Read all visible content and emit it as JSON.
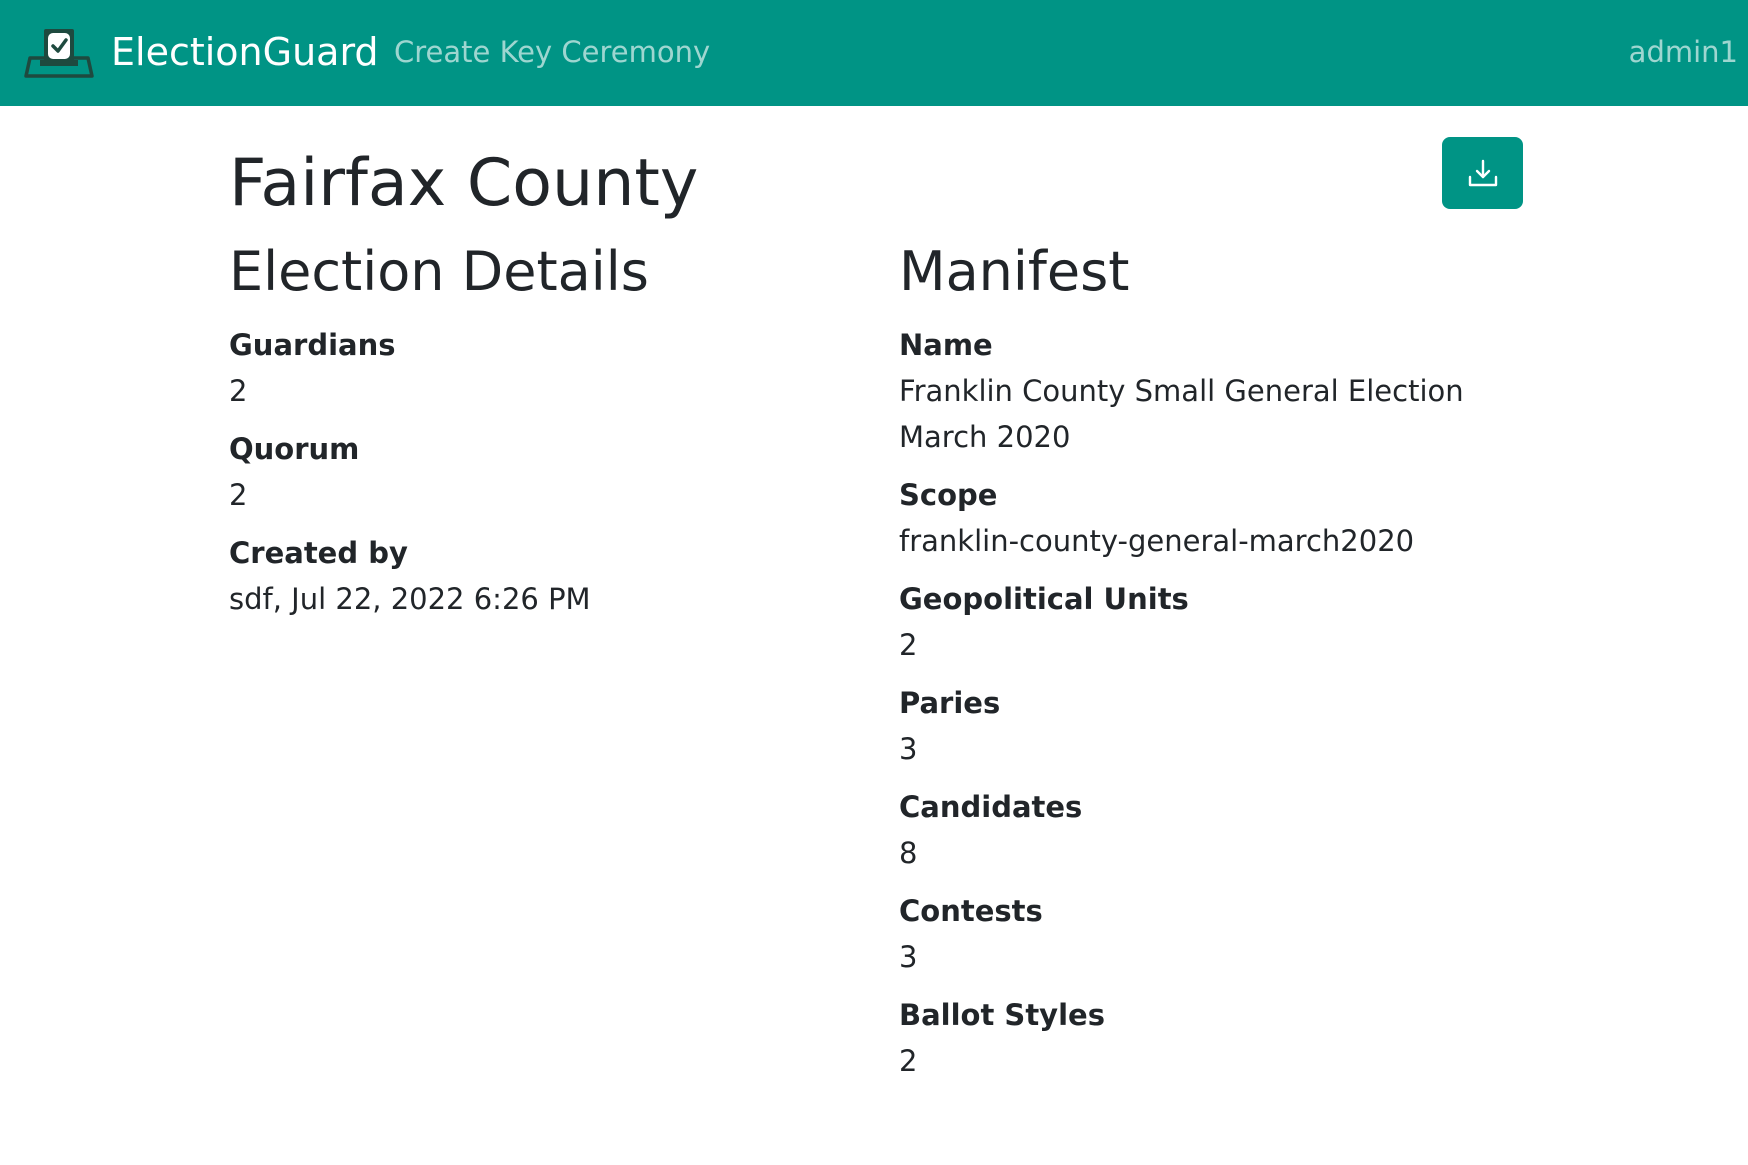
{
  "navbar": {
    "brand": "ElectionGuard",
    "link": "Create Key Ceremony",
    "user": "admin1",
    "logo_icon": "ballot-box-icon",
    "color": "#009485"
  },
  "page": {
    "title": "Fairfax County",
    "download_icon": "download-icon"
  },
  "election_details": {
    "heading": "Election Details",
    "fields": [
      {
        "label": "Guardians",
        "value": "2"
      },
      {
        "label": "Quorum",
        "value": "2"
      },
      {
        "label": "Created by",
        "value": "sdf, Jul 22, 2022 6:26 PM"
      }
    ]
  },
  "manifest": {
    "heading": "Manifest",
    "fields": [
      {
        "label": "Name",
        "value": "Franklin County Small General Election March 2020"
      },
      {
        "label": "Scope",
        "value": "franklin-county-general-march2020"
      },
      {
        "label": "Geopolitical Units",
        "value": "2"
      },
      {
        "label": "Paries",
        "value": "3"
      },
      {
        "label": "Candidates",
        "value": "8"
      },
      {
        "label": "Contests",
        "value": "3"
      },
      {
        "label": "Ballot Styles",
        "value": "2"
      }
    ]
  }
}
